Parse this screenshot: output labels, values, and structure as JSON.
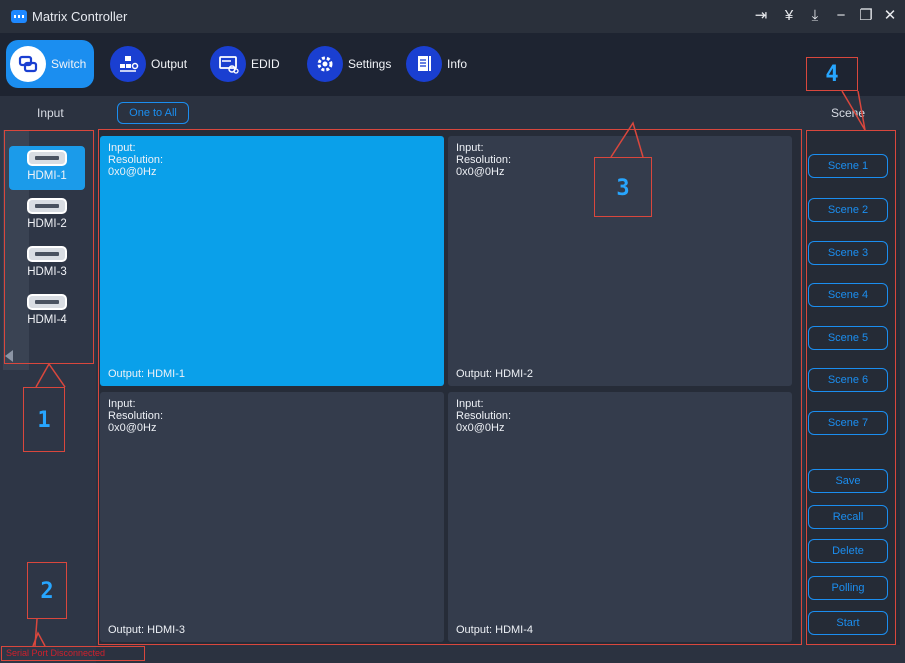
{
  "app": {
    "title": "Matrix Controller"
  },
  "window_controls": [
    "login-icon",
    "collapse-icon",
    "download-icon",
    "minimize-icon",
    "restore-icon",
    "close-icon"
  ],
  "toolbar": {
    "items": [
      {
        "label": "Switch",
        "icon": "switch-icon",
        "active": true
      },
      {
        "label": "Output",
        "icon": "output-icon",
        "active": false
      },
      {
        "label": "EDID",
        "icon": "edid-icon",
        "active": false
      },
      {
        "label": "Settings",
        "icon": "gear-icon",
        "active": false
      },
      {
        "label": "Info",
        "icon": "info-document-icon",
        "active": false
      }
    ]
  },
  "header": {
    "input_label": "Input",
    "one_to_all_label": "One to All",
    "scene_label": "Scene"
  },
  "inputs": [
    {
      "label": "HDMI-1",
      "active": true
    },
    {
      "label": "HDMI-2",
      "active": false
    },
    {
      "label": "HDMI-3",
      "active": false
    },
    {
      "label": "HDMI-4",
      "active": false
    }
  ],
  "outputs": [
    {
      "input_label": "Input:",
      "resolution_label": "Resolution:",
      "resolution": "0x0@0Hz",
      "output_label": "Output: HDMI-1",
      "active": true
    },
    {
      "input_label": "Input:",
      "resolution_label": "Resolution:",
      "resolution": "0x0@0Hz",
      "output_label": "Output: HDMI-2",
      "active": false
    },
    {
      "input_label": "Input:",
      "resolution_label": "Resolution:",
      "resolution": "0x0@0Hz",
      "output_label": "Output: HDMI-3",
      "active": false
    },
    {
      "input_label": "Input:",
      "resolution_label": "Resolution:",
      "resolution": "0x0@0Hz",
      "output_label": "Output: HDMI-4",
      "active": false
    }
  ],
  "scenes": [
    "Scene 1",
    "Scene 2",
    "Scene 3",
    "Scene 4",
    "Scene 5",
    "Scene 6",
    "Scene 7"
  ],
  "scene_actions": [
    "Save",
    "Recall",
    "Delete",
    "Polling",
    "Start"
  ],
  "status": {
    "text": "Serial Port Disconnected"
  },
  "annotations": [
    "1",
    "2",
    "3",
    "4"
  ],
  "colors": {
    "accent": "#1b8ef0",
    "active_cell": "#0aa0ea",
    "annotation_box": "#d9473d",
    "annotation_number": "#27a6ff",
    "status_error": "#d0202c"
  }
}
